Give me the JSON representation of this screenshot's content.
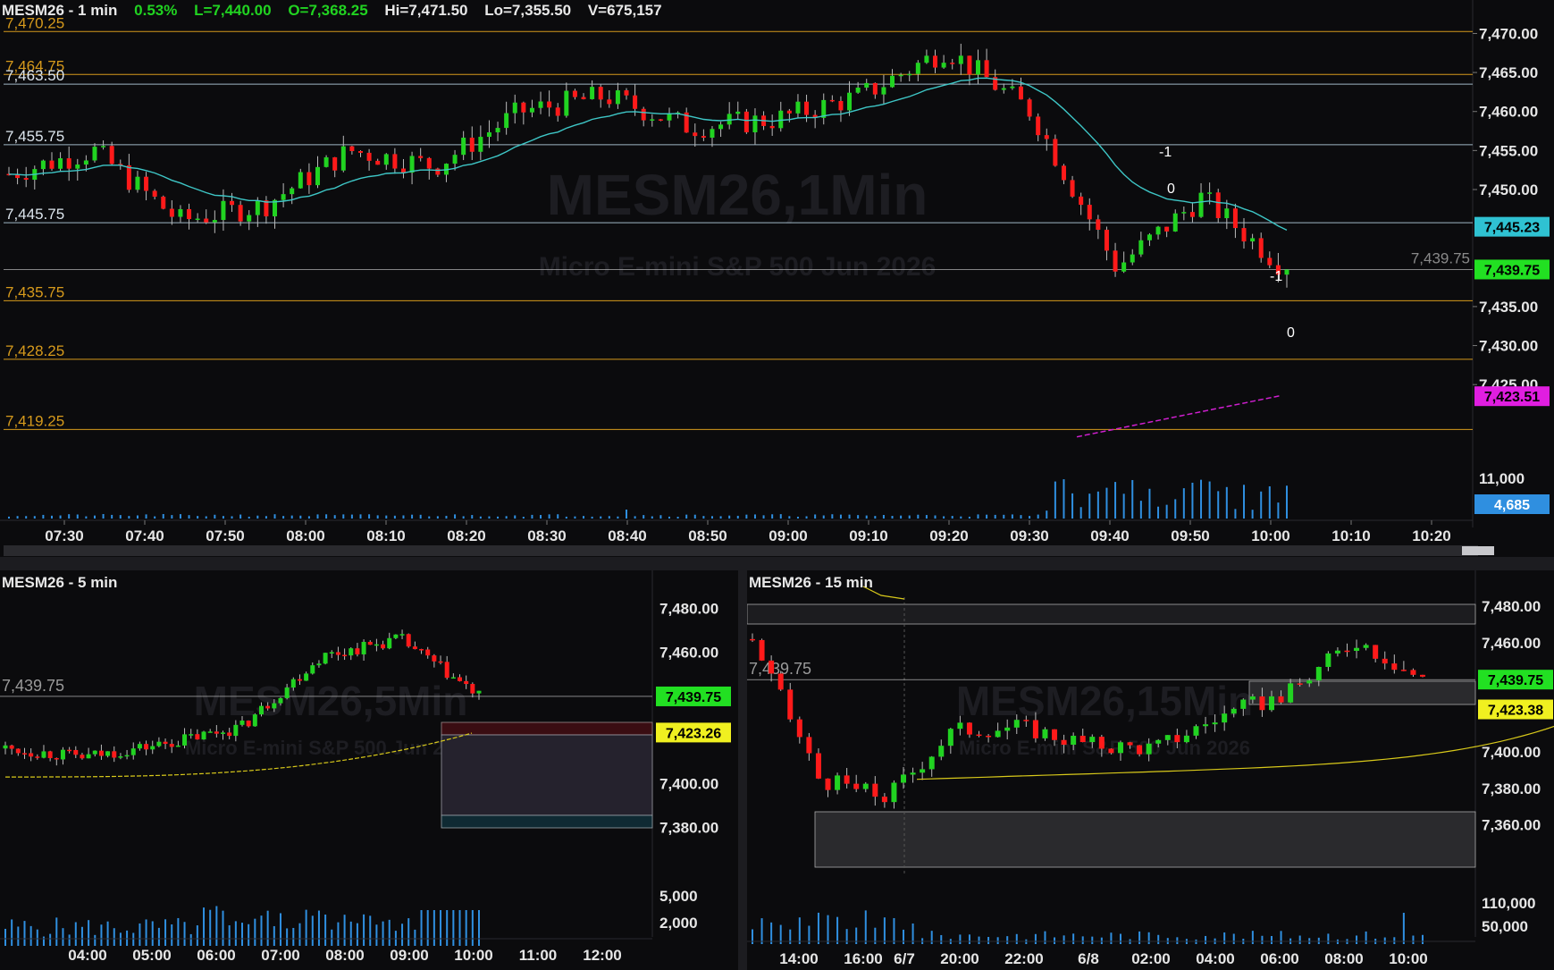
{
  "main": {
    "symbol": "MESM26 - 1 min",
    "change": "0.53%",
    "last": "L=7,440.00",
    "open": "O=7,368.25",
    "high": "Hi=7,471.50",
    "low": "Lo=7,355.50",
    "volume": "V=675,157",
    "watermark": "MESM26,1Min",
    "watermark_sub": "Micro E-mini S&P 500 Jun 2026",
    "level_labels": [
      "7,470.25",
      "7,464.75",
      "7,463.50",
      "7,455.75",
      "7,445.75",
      "7,435.75",
      "7,428.25",
      "7,419.25"
    ],
    "last_price_label": "7,439.75",
    "price_ticks": [
      "7,470.00",
      "7,465.00",
      "7,460.00",
      "7,455.00",
      "7,450.00",
      "7,435.00",
      "7,430.00",
      "7,425.00"
    ],
    "badges": [
      "7,445.23",
      "7,439.75",
      "7,423.51",
      "4,685"
    ],
    "volume_tick": "11,000",
    "time_ticks": [
      "07:30",
      "07:40",
      "07:50",
      "08:00",
      "08:10",
      "08:20",
      "08:30",
      "08:40",
      "08:50",
      "09:00",
      "09:10",
      "09:20",
      "09:30",
      "09:40",
      "09:50",
      "10:00",
      "10:10",
      "10:20"
    ],
    "markers": [
      "-1",
      "0",
      "-1",
      "0"
    ]
  },
  "five": {
    "title": "MESM26 - 5 min",
    "watermark": "MESM26,5Min",
    "watermark_sub": "Micro E-mini S&P 500 Jun 2026",
    "last_price_label": "7,439.75",
    "price_ticks": [
      "7,480.00",
      "7,460.00",
      "7,400.00",
      "7,380.00"
    ],
    "badges": [
      "7,439.75",
      "7,423.26"
    ],
    "volume_ticks": [
      "5,000",
      "2,000"
    ],
    "time_ticks": [
      "04:00",
      "05:00",
      "06:00",
      "07:00",
      "08:00",
      "09:00",
      "10:00",
      "11:00",
      "12:00"
    ]
  },
  "fifteen": {
    "title": "MESM26 - 15 min",
    "watermark": "MESM26,15Min",
    "watermark_sub": "Micro E-mini S&P 500 Jun 2026",
    "last_price_label": "7,439.75",
    "price_ticks": [
      "7,480.00",
      "7,460.00",
      "7,400.00",
      "7,380.00",
      "7,360.00"
    ],
    "badges": [
      "7,439.75",
      "7,423.38"
    ],
    "volume_ticks": [
      "110,000",
      "50,000"
    ],
    "time_ticks": [
      "14:00",
      "16:00",
      "6/7",
      "20:00",
      "22:00",
      "6/8",
      "02:00",
      "04:00",
      "06:00",
      "08:00",
      "10:00"
    ]
  },
  "colors": {
    "up": "#21d321",
    "down": "#ff1a1a",
    "level_orange": "#d69a1c",
    "level_white": "#9fb6c4",
    "ema": "#3ec6c6",
    "vwap": "#d8c91a",
    "sma_magenta": "#d01fd0",
    "volume": "#2f8fe0"
  },
  "chart_data": [
    {
      "type": "candlestick",
      "title": "MESM26 - 1 min",
      "x": [
        "07:30",
        "07:40",
        "07:50",
        "08:00",
        "08:10",
        "08:20",
        "08:30",
        "08:40",
        "08:50",
        "09:00",
        "09:10",
        "09:20",
        "09:30",
        "09:40",
        "09:50",
        "10:00"
      ],
      "close": [
        7452,
        7455,
        7446,
        7448,
        7455,
        7453,
        7460,
        7462,
        7458,
        7459,
        7462,
        7468,
        7460,
        7440,
        7449,
        7439.75
      ],
      "ylim": [
        7417,
        7472
      ],
      "horizontal_levels": [
        7470.25,
        7464.75,
        7463.5,
        7455.75,
        7445.75,
        7435.75,
        7428.25,
        7419.25
      ],
      "ema_last": 7445.23,
      "sma_last": 7423.51,
      "last_volume": 4685
    },
    {
      "type": "candlestick",
      "title": "MESM26 - 5 min",
      "x": [
        "04:00",
        "05:00",
        "06:00",
        "07:00",
        "08:00",
        "09:00",
        "10:00"
      ],
      "close": [
        7416,
        7412,
        7418,
        7426,
        7458,
        7466,
        7439.75
      ],
      "ylim": [
        7370,
        7485
      ],
      "vwap_last": 7423.26
    },
    {
      "type": "candlestick",
      "title": "MESM26 - 15 min",
      "x": [
        "14:00",
        "16:00",
        "6/7",
        "20:00",
        "22:00",
        "6/8",
        "02:00",
        "04:00",
        "06:00",
        "08:00",
        "10:00"
      ],
      "close": [
        7462,
        7385,
        7375,
        7412,
        7414,
        7404,
        7402,
        7420,
        7432,
        7462,
        7439.75
      ],
      "ylim": [
        7350,
        7485
      ],
      "vwap_last": 7423.38
    }
  ]
}
